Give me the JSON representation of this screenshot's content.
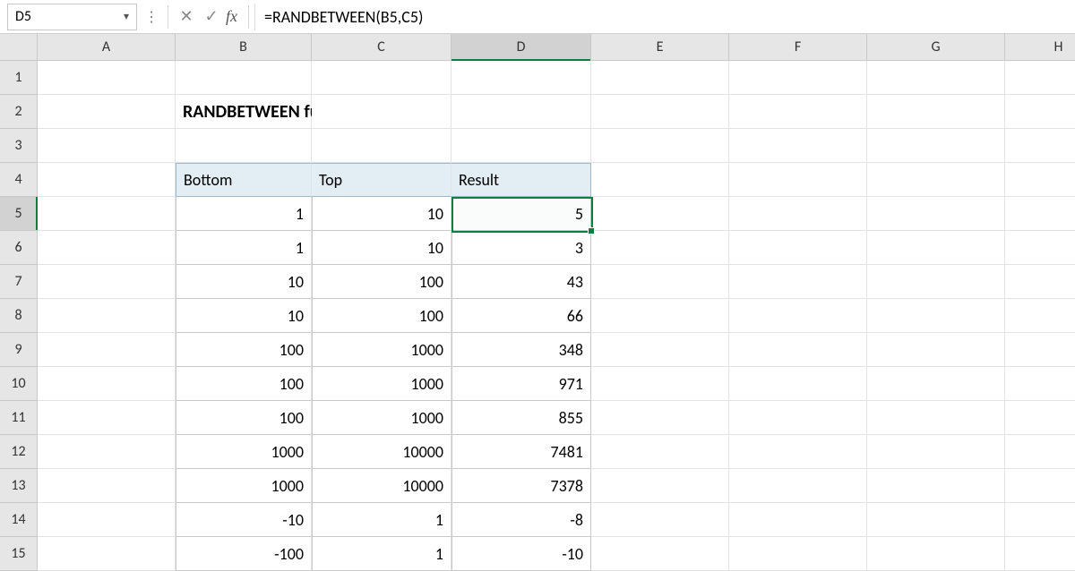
{
  "namebox": "D5",
  "formula": "=RANDBETWEEN(B5,C5)",
  "fx_label": "fx",
  "columns": [
    "A",
    "B",
    "C",
    "D",
    "E",
    "F",
    "G",
    "H"
  ],
  "rows": [
    "1",
    "2",
    "3",
    "4",
    "5",
    "6",
    "7",
    "8",
    "9",
    "10",
    "11",
    "12",
    "13",
    "14",
    "15"
  ],
  "active_col_index": 3,
  "active_row_index": 4,
  "title": "RANDBETWEEN function",
  "headers": {
    "bottom": "Bottom",
    "top": "Top",
    "result": "Result"
  },
  "data_rows": [
    {
      "bottom": "1",
      "top": "10",
      "result": "5"
    },
    {
      "bottom": "1",
      "top": "10",
      "result": "3"
    },
    {
      "bottom": "10",
      "top": "100",
      "result": "43"
    },
    {
      "bottom": "10",
      "top": "100",
      "result": "66"
    },
    {
      "bottom": "100",
      "top": "1000",
      "result": "348"
    },
    {
      "bottom": "100",
      "top": "1000",
      "result": "971"
    },
    {
      "bottom": "100",
      "top": "1000",
      "result": "855"
    },
    {
      "bottom": "1000",
      "top": "10000",
      "result": "7481"
    },
    {
      "bottom": "1000",
      "top": "10000",
      "result": "7378"
    },
    {
      "bottom": "-10",
      "top": "1",
      "result": "-8"
    },
    {
      "bottom": "-100",
      "top": "1",
      "result": "-10"
    }
  ]
}
